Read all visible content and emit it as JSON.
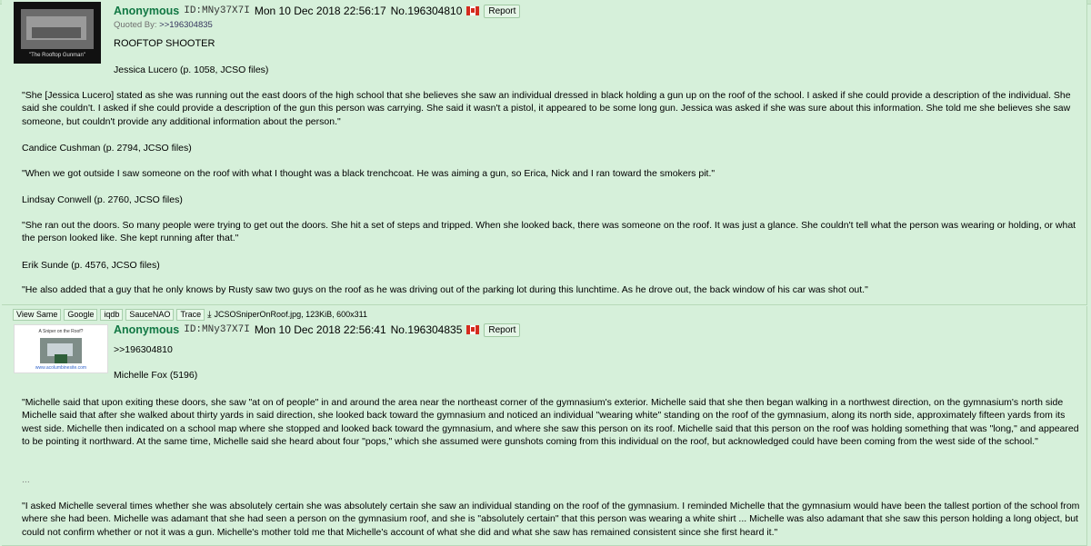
{
  "post1": {
    "name": "Anonymous",
    "id": "ID:MNy37X7I",
    "datetime": "Mon 10 Dec 2018 22:56:17",
    "number": "No.196304810",
    "report": "Report",
    "quoted_prefix": "Quoted By:",
    "quoted_link": ">>196304835",
    "thumb_caption": "\"The Rooftop Gunman\"",
    "body": {
      "l1": "ROOFTOP SHOOTER",
      "l2": "Jessica Lucero (p. 1058, JCSO files)",
      "p1": "\"She [Jessica Lucero] stated as she was running out the east doors of the high school that she believes she saw an individual dressed in black holding a gun up on the roof of the school. I asked if she could provide a description of the individual. She said she couldn't. I asked if she could provide a description of the gun this person was carrying. She said it wasn't a pistol, it appeared to be some long gun. Jessica was asked if she was sure about this information. She told me she believes she saw someone, but couldn't provide any additional information about the person.\"",
      "l3": "Candice Cushman (p. 2794, JCSO files)",
      "p2": "\"When we got outside I saw someone on the roof with what I thought was a black trenchcoat. He was aiming a gun, so Erica, Nick and I ran toward the smokers pit.\"",
      "l4": "Lindsay Conwell (p. 2760, JCSO files)",
      "p3": "\"She ran out the doors. So many people were trying to get out the doors. She hit a set of steps and tripped. When she looked back, there was someone on the roof. It was just a glance. She couldn't tell what the person was wearing or holding, or what the person looked like. She kept running after that.\"",
      "l5": "Erik Sunde (p. 4576, JCSO files)",
      "p4": "\"He also added that a guy that he only knows by Rusty saw two guys on the roof as he was driving out of the parking lot during this lunchtime. As he drove out, the back window of his car was shot out.\""
    }
  },
  "post2": {
    "tools": [
      "View Same",
      "Google",
      "iqdb",
      "SauceNAO",
      "Trace"
    ],
    "file_info": "JCSOSniperOnRoof.jpg, 123KiB, 600x311",
    "name": "Anonymous",
    "id": "ID:MNy37X7I",
    "datetime": "Mon 10 Dec 2018 22:56:41",
    "number": "No.196304835",
    "report": "Report",
    "thumb_title": "A Sniper on the Roof?",
    "thumb_footer": "www.acolumbinesite.com",
    "body": {
      "l1": ">>196304810",
      "l2": "Michelle Fox (5196)",
      "p1": "\"Michelle said that upon exiting these doors, she saw \"at on of people\" in and around the area near the northeast corner of the gymnasium's exterior. Michelle said that she then began walking in a northwest direction, on the gymnasium's north side Michelle said that after she walked about thirty yards in said direction, she looked back toward the gymnasium and noticed an individual \"wearing white\" standing on the roof of the gymnasium, along its north side, approximately fifteen yards from its west side. Michelle then indicated on a school map where she stopped and looked back toward the gymnasium, and where she saw this person on its roof. Michelle said that this person on the roof was holding something that was \"long,\" and appeared to be pointing it northward. At the same time, Michelle said she heard about four \"pops,\" which she assumed were gunshots coming from this individual on the roof, but acknowledged could have been coming from the west side of the school.\"",
      "ellipsis": "...",
      "p2": "\"I asked Michelle several times whether she was absolutely certain she was absolutely certain she saw an individual standing on the roof of the gymnasium. I reminded Michelle that the gymnasium would have been the tallest portion of the school from where she had been. Michelle was adamant that she had seen a person on the gymnasium roof, and she is \"absolutely certain\" that this person was wearing a white shirt ... Michelle was also adamant that she saw this person holding a long object, but could not confirm whether or not it was a gun. Michelle's mother told me that Michelle's account of what she did and what she saw has remained consistent since she first heard it.\""
    }
  }
}
